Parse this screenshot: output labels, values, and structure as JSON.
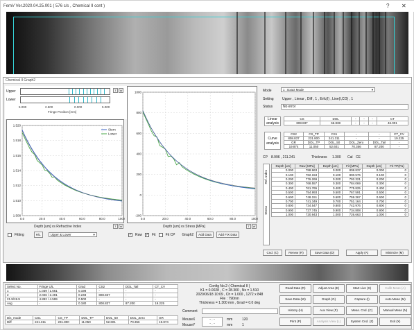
{
  "window": {
    "title": "FemV Ver.2020.04.25.001 ( 576 c/s , Chemical II cont )",
    "help": "?",
    "close": "✕"
  },
  "graph_window": {
    "title": "Chemical II  Graph2"
  },
  "fringe_panel": {
    "upper_label": "Upper",
    "lower_label": "Lower",
    "tick_labels": [
      "5.000",
      "2.500",
      "0.000",
      "5.000"
    ],
    "xlabel": "Fringe Position [mm]"
  },
  "plot1": {
    "y_ticks": [
      "1.520",
      "1.518",
      "1.516",
      "1.514",
      "1.512",
      "1.510",
      "1.508"
    ],
    "x_ticks": [
      "0.0",
      "20.0",
      "40.0",
      "60.0",
      "80.0",
      "100.0"
    ],
    "legend": [
      "Stern",
      "Lower"
    ],
    "xlabel": "Depth [um] vs Refractive Index",
    "fitting_label": "Fitting",
    "hl_button": "H/L",
    "mode_select": "Upper & Lower",
    "tw": "T W"
  },
  "plot2": {
    "y_ticks": [
      "1000",
      "800",
      "600",
      "400",
      "200",
      "0",
      "-200"
    ],
    "x_ticks": [
      "0.0",
      "20.0",
      "40.0",
      "60.0",
      "80.0",
      "100.0"
    ],
    "xlabel": "Depth [um] vs Stress [MPa]",
    "raw_label": "Raw",
    "fit_label": "Fit",
    "fitcp_label": "Fit CP",
    "graph_label": "Graph2",
    "add_data": "Add Data",
    "add_fit": "Add FIX Data",
    "tw": "T W"
  },
  "right_panel": {
    "mode_label": "Mode",
    "mode_value": "1 : Exact Mode",
    "setting_label": "Setting",
    "setting_value": "Upper , Linear , Diff , 1 , Erfc(I) , Line(I,CO) , 1",
    "status_label": "Status",
    "status_value": "No error",
    "linear_label": "Linear analysis",
    "linear_header": [
      "CS",
      "DOL",
      "-",
      "-",
      "-",
      "CT"
    ],
    "linear_values": [
      "808.837",
      "66.838",
      "-",
      "-",
      "-",
      "46.001"
    ],
    "curve_label": "Curve analysis",
    "curve_header1": [
      "CS2",
      "CS_TP",
      "CS1",
      "-",
      "-",
      "CT_CV"
    ],
    "curve_values1": [
      "808.837",
      "231.800",
      "241.311",
      "-",
      "-",
      "19.225"
    ],
    "curve_header2": [
      "GR",
      "DOL_TP",
      "DOL_50",
      "DOL_Zero",
      "DOL_Tail",
      "-"
    ],
    "curve_values2": [
      "19.874",
      "11.050",
      "52.601",
      "70.356",
      "87.200",
      "-"
    ],
    "cp_label": "CP",
    "cp_value": "8.996 , 211.241",
    "thickness_label": "Thickness",
    "thickness_value": "1.300",
    "cal_label": "Cal",
    "cal_value": "CE",
    "side_tab1": "Ref. Index",
    "side_tab2": "Stress",
    "data_headers": [
      "Depth [um]",
      "Raw [MPa]",
      "Depth [um]",
      "Fit [MPa]",
      "Depth [um]",
      "Fit TP(Pa)"
    ],
    "data_rows": [
      [
        "0.000",
        "788.963",
        "0.000",
        "808.837",
        "0.000",
        "0"
      ],
      [
        "0.100",
        "782.153",
        "0.100",
        "800.576",
        "0.100",
        "0"
      ],
      [
        "0.200",
        "776.269",
        "0.200",
        "792.321",
        "0.200",
        "0"
      ],
      [
        "0.300",
        "768.557",
        "0.300",
        "784.069",
        "0.300",
        "0"
      ],
      [
        "0.400",
        "761.765",
        "0.400",
        "775.825",
        "0.400",
        "0"
      ],
      [
        "0.500",
        "754.993",
        "0.500",
        "767.591",
        "0.500",
        "0"
      ],
      [
        "0.600",
        "748.151",
        "0.600",
        "759.367",
        "0.600",
        "0"
      ],
      [
        "0.700",
        "741.349",
        "0.700",
        "751.164",
        "0.700",
        "0"
      ],
      [
        "0.800",
        "734.547",
        "0.800",
        "742.976",
        "0.800",
        "0"
      ],
      [
        "0.900",
        "727.745",
        "0.900",
        "734.808",
        "0.900",
        "0"
      ],
      [
        "1.000",
        "720.943",
        "1.000",
        "726.663",
        "1.000",
        "0"
      ]
    ],
    "buttons": [
      "Cnd. (C)",
      "Renew (R)",
      "Save Data (D)",
      "Apply (A)",
      "Minimize (M)"
    ]
  },
  "bottom_left": {
    "headers": [
      "Select No.",
      "Fringe U/L",
      "Grad",
      "CS2",
      "DOL_Tail",
      "CT_CV"
    ],
    "rows": [
      [
        "1",
        "1.039 / 1.661",
        "0.198",
        "-",
        "-",
        "-"
      ],
      [
        "2",
        "2.026 / 2.491",
        "0.248",
        "808.837",
        "-",
        "-"
      ],
      [
        "21.9/19.9",
        "4.892 / 4.599",
        "0.500",
        "-",
        "-",
        "-"
      ],
      [
        "Avg",
        "-",
        "0.180",
        "808.837",
        "87.200",
        "19.225"
      ]
    ],
    "headers2": [
      "Dis_mode",
      "CS1",
      "CS_TP",
      "DOL_TP",
      "DOL_50",
      "DOL_Zero",
      "GR"
    ],
    "values2": [
      "Diff",
      "241.311",
      "231.800",
      "11.050",
      "52.601",
      "70.356",
      "19.874"
    ]
  },
  "info": {
    "line1": "Config No.2 ( Chemical II )",
    "line2": "K1 = 0.0028 , C = 28.300 , Ns = 1.510",
    "line3": "2020/06/18 10:09 , Ch = 1.000 , 1272 x 848",
    "line4": "File : 790nm",
    "line5": "Thickness = 1.300 mm , Grad = 0.0 deg",
    "comment_label": "Comment",
    "mouse_x": "MouseX",
    "mouse_y": "MouseY",
    "mm": "mm",
    "val_120": "120",
    "val_1": "1"
  },
  "action_buttons": [
    {
      "label": "Read Data (R)",
      "disabled": false
    },
    {
      "label": "Adjust Area (E)",
      "disabled": false
    },
    {
      "label": "Start Live (S)",
      "disabled": false
    },
    {
      "label": "Calib Meas (A)",
      "disabled": true
    },
    {
      "label": "Save Data (W)",
      "disabled": false
    },
    {
      "label": "Graph (G)",
      "disabled": false
    },
    {
      "label": "Capture (I)",
      "disabled": false
    },
    {
      "label": "Auto Meas (M)",
      "disabled": false
    },
    {
      "label": "History (H)",
      "disabled": false
    },
    {
      "label": "Aux View (F)",
      "disabled": false
    },
    {
      "label": "Meas. Cnd. (C)",
      "disabled": false
    },
    {
      "label": "Manual Meas (N)",
      "disabled": false
    },
    {
      "label": "Print (P)",
      "disabled": false
    },
    {
      "label": "Analysis View (L)",
      "disabled": true
    },
    {
      "label": "System Cnd. (Z)",
      "disabled": false
    },
    {
      "label": "Exit (X)",
      "disabled": false
    }
  ],
  "colors": {
    "accent": "#35d2d6",
    "series_blue": "#3b63c4",
    "series_green": "#4aa84a",
    "series_gray": "#666666"
  }
}
